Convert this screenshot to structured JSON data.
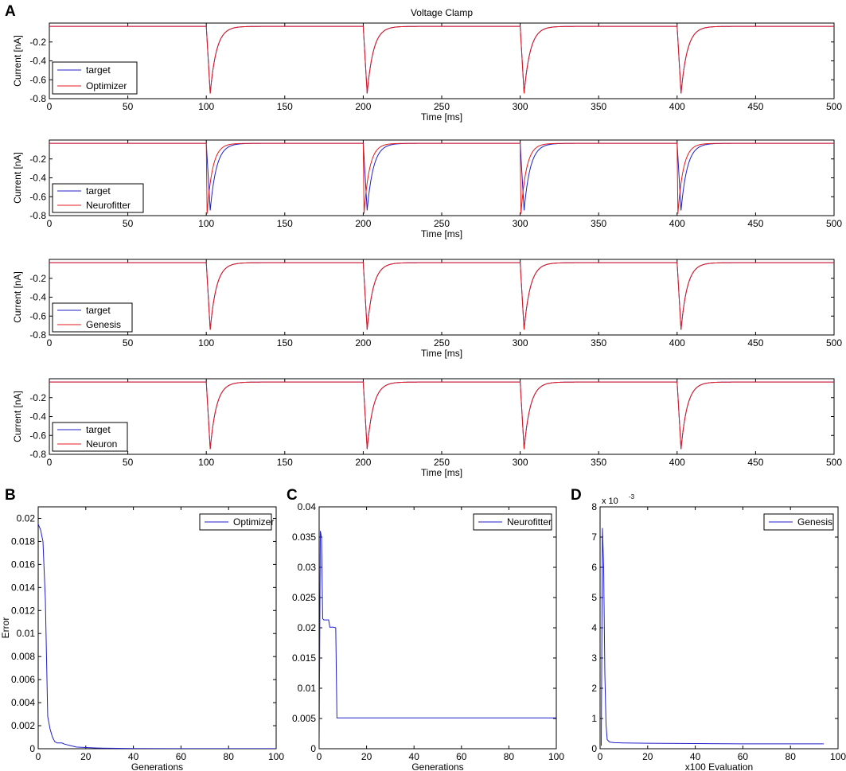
{
  "figure": {
    "panel_letters": [
      "A",
      "B",
      "C",
      "D"
    ]
  },
  "colors": {
    "target": "#1f1fcc",
    "fit": "#e41a1c",
    "axis": "#000000"
  },
  "chart_data": [
    {
      "id": "A1",
      "type": "line",
      "title": "Voltage Clamp",
      "xlabel": "Time [ms]",
      "ylabel": "Current [nA]",
      "xlim": [
        0,
        500
      ],
      "ylim": [
        -0.8,
        0.0
      ],
      "xticks": [
        0,
        50,
        100,
        150,
        200,
        250,
        300,
        350,
        400,
        450,
        500
      ],
      "yticks": [
        -0.2,
        -0.4,
        -0.6,
        -0.8
      ],
      "legend_position": "bottom-left",
      "pulses": [
        100,
        200,
        300,
        400
      ],
      "baseline": -0.035,
      "series": [
        {
          "name": "target",
          "color": "#1f1fcc",
          "peak": -0.745,
          "peak_delay": 2.5,
          "tau": 4.0
        },
        {
          "name": "Optimizer",
          "color": "#e41a1c",
          "peak": -0.745,
          "peak_delay": 2.5,
          "tau": 4.0
        }
      ]
    },
    {
      "id": "A2",
      "type": "line",
      "xlabel": "Time [ms]",
      "ylabel": "Current [nA]",
      "xlim": [
        0,
        500
      ],
      "ylim": [
        -0.8,
        0.0
      ],
      "xticks": [
        0,
        50,
        100,
        150,
        200,
        250,
        300,
        350,
        400,
        450,
        500
      ],
      "yticks": [
        -0.2,
        -0.4,
        -0.6,
        -0.8
      ],
      "legend_position": "bottom-left",
      "pulses": [
        100,
        200,
        300,
        400
      ],
      "baseline": -0.035,
      "series": [
        {
          "name": "target",
          "color": "#1f1fcc",
          "peak": -0.745,
          "peak_delay": 2.5,
          "tau": 4.0
        },
        {
          "name": "Neurofitter",
          "color": "#e41a1c",
          "peak": -0.78,
          "peak_delay": 0.5,
          "tau": 3.5
        }
      ]
    },
    {
      "id": "A3",
      "type": "line",
      "xlabel": "Time [ms]",
      "ylabel": "Current [nA]",
      "xlim": [
        0,
        500
      ],
      "ylim": [
        -0.8,
        0.0
      ],
      "xticks": [
        0,
        50,
        100,
        150,
        200,
        250,
        300,
        350,
        400,
        450,
        500
      ],
      "yticks": [
        -0.2,
        -0.4,
        -0.6,
        -0.8
      ],
      "legend_position": "bottom-left",
      "pulses": [
        100,
        200,
        300,
        400
      ],
      "baseline": -0.035,
      "series": [
        {
          "name": "target",
          "color": "#1f1fcc",
          "peak": -0.745,
          "peak_delay": 2.5,
          "tau": 4.0
        },
        {
          "name": "Genesis",
          "color": "#e41a1c",
          "peak": -0.745,
          "peak_delay": 2.5,
          "tau": 4.0
        }
      ]
    },
    {
      "id": "A4",
      "type": "line",
      "xlabel": "Time [ms]",
      "ylabel": "Current [nA]",
      "xlim": [
        0,
        500
      ],
      "ylim": [
        -0.8,
        0.0
      ],
      "xticks": [
        0,
        50,
        100,
        150,
        200,
        250,
        300,
        350,
        400,
        450,
        500
      ],
      "yticks": [
        -0.2,
        -0.4,
        -0.6,
        -0.8
      ],
      "legend_position": "bottom-left",
      "pulses": [
        100,
        200,
        300,
        400
      ],
      "baseline": -0.035,
      "series": [
        {
          "name": "target",
          "color": "#1f1fcc",
          "peak": -0.745,
          "peak_delay": 2.5,
          "tau": 4.0
        },
        {
          "name": "Neuron",
          "color": "#e41a1c",
          "peak": -0.745,
          "peak_delay": 2.5,
          "tau": 4.0
        }
      ]
    },
    {
      "id": "B",
      "type": "line",
      "xlabel": "Generations",
      "ylabel": "Error",
      "xlim": [
        0,
        100
      ],
      "ylim": [
        0,
        0.021
      ],
      "xticks": [
        0,
        20,
        40,
        60,
        80,
        100
      ],
      "yticks": [
        0,
        0.002,
        0.004,
        0.006,
        0.008,
        0.01,
        0.012,
        0.014,
        0.016,
        0.018,
        0.02
      ],
      "ytick_labels": [
        "0",
        "0.002",
        "0.004",
        "0.006",
        "0.008",
        "0.01",
        "0.012",
        "0.014",
        "0.016",
        "0.018",
        "0.02"
      ],
      "legend_position": "top-right",
      "series": [
        {
          "name": "Optimizer",
          "color": "#1f1fcc",
          "x": [
            0,
            1,
            2,
            3,
            4,
            5,
            6,
            7,
            8,
            9,
            10,
            11,
            12,
            13,
            14,
            16,
            20,
            25,
            30,
            40,
            60,
            80,
            100
          ],
          "y": [
            0.0195,
            0.019,
            0.018,
            0.013,
            0.0028,
            0.0017,
            0.001,
            0.0006,
            0.0005,
            0.0005,
            0.0005,
            0.0004,
            0.00035,
            0.0003,
            0.00025,
            0.00015,
            0.0001,
            6e-05,
            4e-05,
            2e-05,
            1e-05,
            1e-05,
            1e-05
          ]
        }
      ]
    },
    {
      "id": "C",
      "type": "line",
      "xlabel": "Generations",
      "xlim": [
        0,
        100
      ],
      "ylim": [
        0,
        0.04
      ],
      "xticks": [
        0,
        20,
        40,
        60,
        80,
        100
      ],
      "yticks": [
        0,
        0.005,
        0.01,
        0.015,
        0.02,
        0.025,
        0.03,
        0.035,
        0.04
      ],
      "ytick_labels": [
        "0",
        "0.005",
        "0.01",
        "0.015",
        "0.02",
        "0.025",
        "0.03",
        "0.035",
        "0.04"
      ],
      "legend_position": "top-right",
      "series": [
        {
          "name": "Neurofitter",
          "color": "#1f1fcc",
          "x": [
            0,
            0.5,
            1,
            1.5,
            2,
            3,
            4,
            4.5,
            5,
            6,
            7,
            7.5,
            8,
            100
          ],
          "y": [
            0.0,
            0.036,
            0.035,
            0.0215,
            0.0213,
            0.0213,
            0.0213,
            0.0201,
            0.0201,
            0.0201,
            0.02,
            0.0051,
            0.0051,
            0.0051
          ]
        }
      ]
    },
    {
      "id": "D",
      "type": "line",
      "xlabel": "x100 Evaluation",
      "xlim": [
        0,
        100
      ],
      "ylim": [
        0,
        8
      ],
      "xticks": [
        0,
        20,
        40,
        60,
        80,
        100
      ],
      "yticks": [
        0,
        1,
        2,
        3,
        4,
        5,
        6,
        7,
        8
      ],
      "ytick_labels": [
        "0",
        "1",
        "2",
        "3",
        "4",
        "5",
        "6",
        "7",
        "8"
      ],
      "y_multiplier_base": "x 10",
      "y_multiplier_exp": "-3",
      "legend_position": "top-right",
      "series": [
        {
          "name": "Genesis",
          "color": "#1f1fcc",
          "x": [
            0.5,
            1,
            1.5,
            2,
            2.5,
            3,
            4,
            6,
            10,
            20,
            40,
            60,
            80,
            94
          ],
          "y": [
            0.1,
            7.3,
            6.0,
            2.5,
            0.8,
            0.3,
            0.22,
            0.2,
            0.19,
            0.18,
            0.17,
            0.16,
            0.16,
            0.16
          ]
        }
      ]
    }
  ]
}
